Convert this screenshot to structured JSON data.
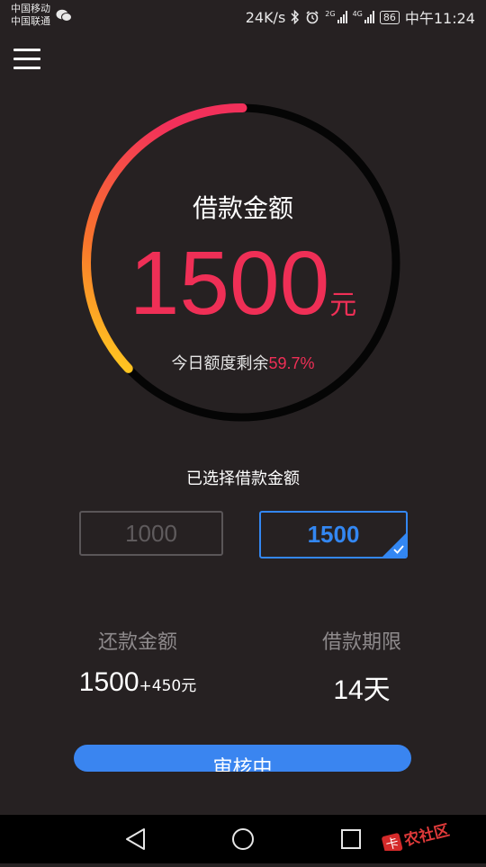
{
  "status_bar": {
    "carrier_1": "中国移动",
    "carrier_2": "中国联通",
    "speed": "24K/s",
    "net_1": "2G",
    "net_2": "4G",
    "battery": "86",
    "time": "中午11:24"
  },
  "gauge": {
    "title": "借款金额",
    "amount": "1500",
    "unit": "元",
    "remain_label": "今日额度剩余",
    "remain_percent": "59.7%",
    "remain_value": 0.597
  },
  "selection": {
    "label": "已选择借款金额",
    "options": [
      {
        "value": "1000",
        "selected": false
      },
      {
        "value": "1500",
        "selected": true
      }
    ]
  },
  "summary": {
    "repay_label": "还款金额",
    "repay_principal": "1500",
    "repay_fee": "+450元",
    "term_label": "借款期限",
    "term_value": "14天"
  },
  "action": {
    "label": "审核中"
  },
  "watermark": {
    "text": "卡农社区"
  },
  "colors": {
    "accent_red": "#ef2f56",
    "accent_blue": "#3387f2",
    "background": "#262122"
  }
}
